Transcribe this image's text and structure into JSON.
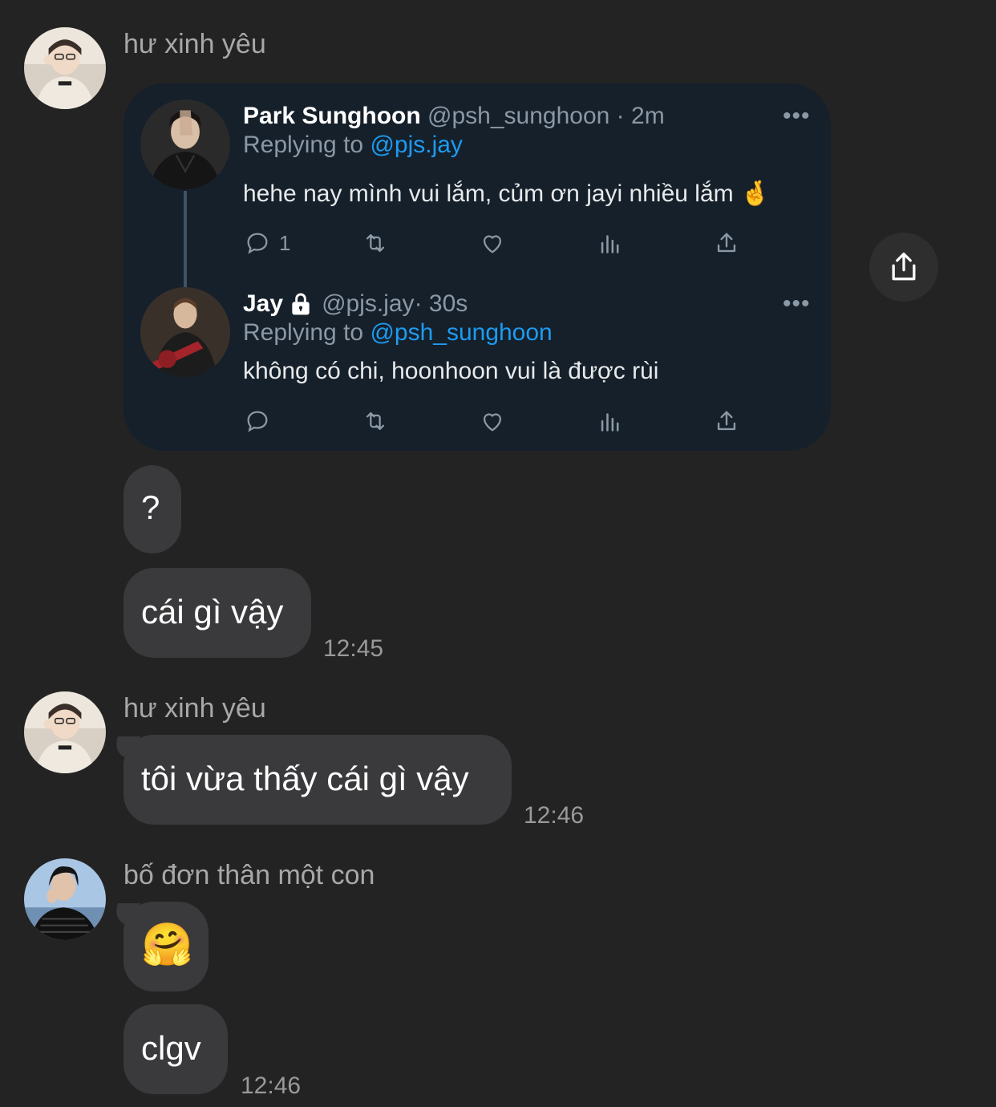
{
  "messages": {
    "group1": {
      "sender": "hư xinh yêu",
      "bubble_q": "?",
      "bubble_text": "cái gì vậy",
      "time": "12:45"
    },
    "group2": {
      "sender": "hư xinh yêu",
      "bubble_text": "tôi vừa thấy cái gì vậy",
      "time": "12:46"
    },
    "group3": {
      "sender": "bố đơn thân một con",
      "bubble_emoji": "🤗",
      "bubble_text": "clgv",
      "time": "12:46"
    }
  },
  "tweet": {
    "first": {
      "name": "Park Sunghoon",
      "handle": "@psh_sunghoon",
      "sep_time": " · 2m",
      "replying_prefix": "Replying to ",
      "replying_to": "@pjs.jay",
      "text": "hehe nay mình vui lắm, củm ơn jayi nhiều lắm 🤞",
      "reply_count": "1",
      "more": "•••"
    },
    "second": {
      "name": "Jay",
      "handle": "@pjs.jay",
      "sep_time": " · 30s",
      "replying_prefix": "Replying to ",
      "replying_to": "@psh_sunghoon",
      "text": "không có chi, hoonhoon vui là được rùi",
      "more": "•••"
    }
  },
  "icons": {
    "share": "share-icon",
    "reply": "reply-icon",
    "retweet": "retweet-icon",
    "like": "heart-icon",
    "views": "views-icon",
    "lock": "lock-icon"
  },
  "colors": {
    "background": "#232323",
    "bubble": "#3a3a3c",
    "tweet_card": "#15202b",
    "mention": "#1d9bf0",
    "muted": "#8b98a5"
  }
}
